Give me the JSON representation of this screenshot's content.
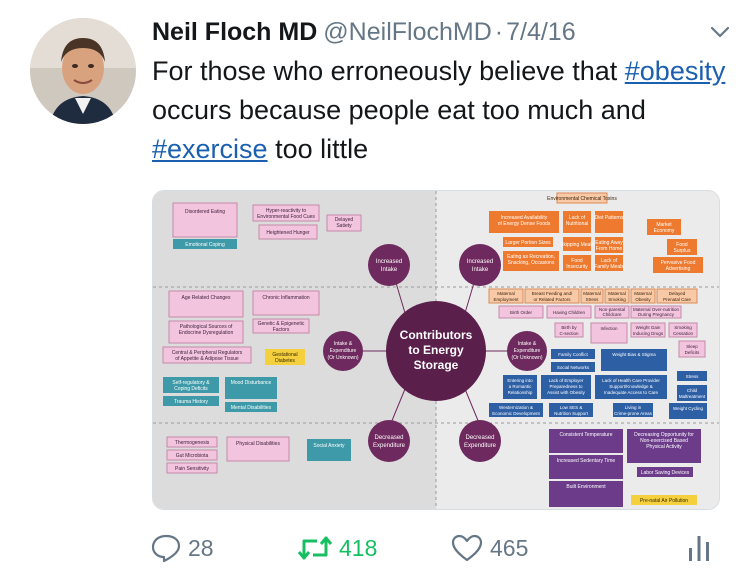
{
  "tweet": {
    "author_name": "Neil Floch MD",
    "handle": "@NeilFlochMD",
    "separator": "·",
    "date": "7/4/16",
    "text_parts": {
      "t1": "For those who erroneously believe that ",
      "tag1": "#obesity",
      "t2": " occurs because people eat too much and ",
      "tag2": "#exercise",
      "t3": " too little"
    }
  },
  "image": {
    "center_title": "Contributors to Energy Storage",
    "nodes": {
      "increased_intake_left": "Increased Intake",
      "increased_intake_right": "Increased Intake",
      "intake_expenditure_left": "Intake & Expenditure (Or Unknown)",
      "intake_expenditure_right": "Intake & Expenditure (Or Unknown)",
      "decreased_expenditure_left": "Decreased Expenditure",
      "decreased_expenditure_right": "Decreased Expenditure"
    },
    "boxes": {
      "disordered_eating": "Disordered Eating",
      "emotional_coping": "Emotional Coping",
      "hyper_reactivity": "Hyper-reactivity to Environmental Food Cues",
      "heightened_hunger": "Heightened Hunger Response",
      "delayed_satiety": "Delayed Satiety",
      "age_related": "Age Related Changes",
      "chronic_inflammation": "Chronic Inflammation",
      "pathological_sources": "Pathological Sources of Endocrine Dysregulation",
      "genetic_epigenetic": "Genetic & Epigenetic Factors",
      "central_peripheral": "Central & Peripheral Regulators of Appetite & Adipose Tissue",
      "gestational_diabetes": "Gestational Diabetes",
      "self_regulation": "Self-regulatory & Coping Deficits",
      "trauma_history": "Trauma History",
      "mood_disturbance": "Mood Disturbance",
      "mental_disabilities": "Mental Disabilities",
      "thermogenesis": "Thermogenesis",
      "gut_microbiota": "Gut Microbiota",
      "pain_sensitivity": "Pain Sensitivity",
      "physical_disabilities": "Physical Disabilities",
      "social_anxiety": "Social Anxiety",
      "environmental_toxins": "Environmental Chemical Toxins",
      "increased_availability": "Increased Availability of Energy Dense, Nutrient Poor Foods & Beverages",
      "lack_nutritional_education": "Lack of Nutritional Education",
      "diet_patterns": "Diet Patterns",
      "market_economy": "Market Economy",
      "larger_portion": "Larger Portion Sizes",
      "skipping_meals": "Skipping Meals",
      "eating_away": "Eating Away From Home",
      "food_surplus": "Food Surplus",
      "eating_recreation": "Eating as Recreation, Snacking, Special Occasions",
      "food_insecurity": "Food Insecurity",
      "lack_family_meals": "Lack of Family Meals",
      "pervasive_food_ads": "Pervasive Food Advertising",
      "maternal_employment": "Maternal Employment",
      "breast_feeding": "Breast Feeding and/ or Related Factors",
      "maternal_stress": "Maternal Stress",
      "maternal_smoking": "Maternal Smoking",
      "maternal_obesity": "Maternal Obesity",
      "delayed_prenatal_care": "Delayed Prenatal Care",
      "birth_order": "Birth Order",
      "having_children": "Having Children",
      "nonparental_childcare": "Non-parental Childcare",
      "maternal_overnutrition": "Maternal Over-nutrition During Pregnancy",
      "birth_c_section": "Birth by C-section",
      "infection": "Infection",
      "weight_gain_drugs": "Weight Gain Inducing Drugs",
      "smoking_cessation": "Smoking Cessation",
      "sleep_deficits": "Sleep Deficits",
      "family_conflict": "Family Conflict",
      "social_networks": "Social Networks",
      "weight_bias_stigma": "Weight Bias & Stigma",
      "stress": "Stress",
      "entering_relationship": "Entering into a Romantic Relationship",
      "lack_employer": "Lack of Employer Preparedness to Assist with Obesity",
      "lack_health_care": "Lack of Health Care Provider Support/Knowledge & Inadequate Access to Care",
      "child_maltreatment": "Child Maltreatment",
      "westernization": "Westernization & Economic Development",
      "low_ses": "Low SES & Nutrition Support",
      "living_crime": "Living in Crime-prone Areas",
      "weight_cycling": "Weight Cycling",
      "consistent_temperature": "Consistent Temperature",
      "decreasing_opportunity": "Decreasing Opportunity for Non-exercised Based Physical Activity",
      "increased_sedentary": "Increased Sedentary Time",
      "labor_saving": "Labor Saving Devices",
      "built_environment": "Built Environment",
      "prenatal_air_pollution": "Pre-natal Air Pollution"
    }
  },
  "actions": {
    "reply_count": "28",
    "retweet_count": "418",
    "like_count": "465"
  },
  "colors": {
    "hashtag": "#1b5fb0",
    "retweet": "#17bf63",
    "muted": "#657786",
    "center_circle": "#5b1f4c",
    "node_circle": "#6e2a5e",
    "pink_box": "#f2c4dd",
    "teal_box": "#3e9aa8",
    "orange_box": "#ee7a2f",
    "blue_box": "#2d5fa5",
    "purple_box": "#6c3b8a",
    "yellow_box": "#f4d03f"
  },
  "icons": [
    "chevron-down-icon",
    "reply-icon",
    "retweet-icon",
    "like-icon",
    "share-icon"
  ]
}
